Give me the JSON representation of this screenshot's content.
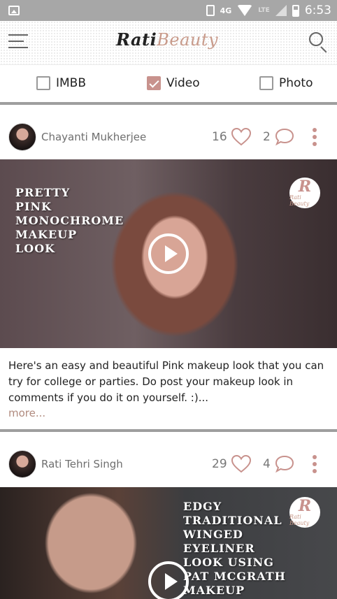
{
  "status_bar": {
    "time": "6:53",
    "network": "4G",
    "lte": "LTE",
    "icons": [
      "image-icon",
      "vibrate-icon",
      "wifi-icon",
      "signal-icon",
      "battery-icon"
    ]
  },
  "header": {
    "logo_part1": "Rati",
    "logo_part2": "Beauty",
    "menu_icon": "hamburger-icon",
    "search_icon": "search-icon"
  },
  "filters": [
    {
      "label": "IMBB",
      "checked": false
    },
    {
      "label": "Video",
      "checked": true
    },
    {
      "label": "Photo",
      "checked": false
    }
  ],
  "colors": {
    "accent": "#c8928d",
    "divider": "#9e9e9e",
    "status_bar": "#a7a7a7"
  },
  "posts": [
    {
      "author": "Chayanti Mukherjee",
      "likes": "16",
      "comments": "2",
      "overlay_text": "PRETTY\nPINK\nMONOCHROME\nMAKEUP\nLOOK",
      "caption": "Here's an easy and beautiful Pink makeup look that you can try for college or parties. Do post your makeup look in comments if you do it on yourself. :)...",
      "more": "more..."
    },
    {
      "author": "Rati Tehri Singh",
      "likes": "29",
      "comments": "4",
      "overlay_text": "EDGY\nTRADITIONAL\nWINGED\nEYELINER\nLOOK USING\nPAT MCGRATH\nMAKEUP"
    }
  ],
  "badge": {
    "letter": "R",
    "text": "Rati Beauty"
  }
}
